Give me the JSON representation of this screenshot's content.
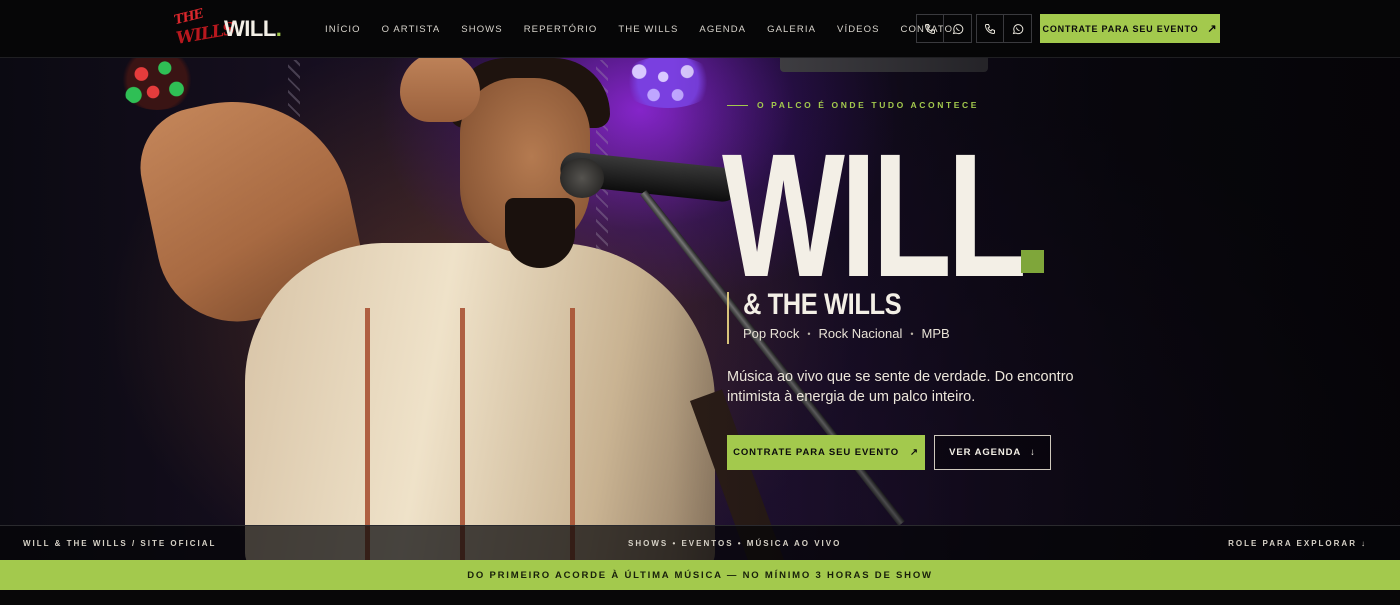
{
  "header": {
    "logo_mark_text": "THE WILLS",
    "brand": "WILL",
    "brand_dot": ".",
    "nav": [
      "INÍCIO",
      "O ARTISTA",
      "SHOWS",
      "REPERTÓRIO",
      "THE WILLS",
      "AGENDA",
      "GALERIA",
      "VÍDEOS",
      "CONTATO"
    ],
    "contact_icons": [
      "phone-icon",
      "whatsapp-icon",
      "phone-icon",
      "whatsapp-icon"
    ],
    "cta_label": "CONTRATE PARA SEU EVENTO",
    "cta_icon": "arrow-up-right-icon"
  },
  "hero": {
    "eyebrow": "O PALCO É ONDE TUDO ACONTECE",
    "title": "WILL",
    "band": "& THE WILLS",
    "genres": [
      "Pop Rock",
      "Rock Nacional",
      "MPB"
    ],
    "tagline": "Música ao vivo que se sente de verdade. Do encontro intimista à energia de um palco inteiro.",
    "primary_cta": "CONTRATE PARA SEU EVENTO",
    "secondary_cta": "VER AGENDA"
  },
  "meta_bar": {
    "left": "WILL & THE WILLS / SITE OFICIAL",
    "center": "SHOWS • EVENTOS • MÚSICA AO VIVO",
    "right": "ROLE PARA EXPLORAR",
    "right_icon": "arrow-down-icon"
  },
  "strip": {
    "text": "DO PRIMEIRO ACORDE À ÚLTIMA MÚSICA — NO MÍNIMO 3 HORAS DE SHOW"
  },
  "colors": {
    "accent": "#a3c94d",
    "background": "#060607",
    "text": "#f3efe6",
    "logo_red": "#d8272c"
  }
}
